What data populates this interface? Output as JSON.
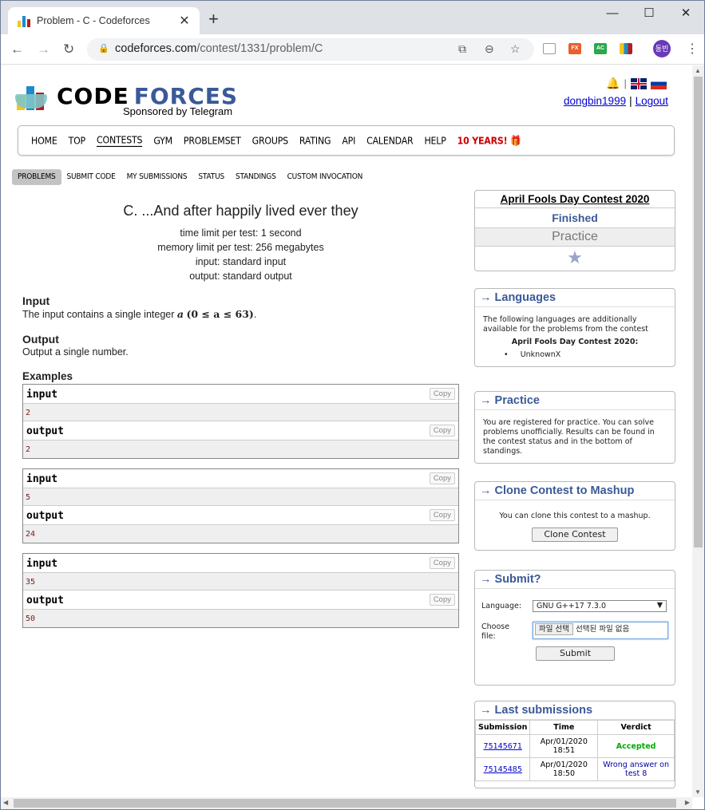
{
  "browser": {
    "tab_title": "Problem - C - Codeforces",
    "url_host": "codeforces.com",
    "url_path": "/contest/1331/problem/C",
    "profile_initials": "동빈",
    "extensions": [
      {
        "name": "FX",
        "color": "#e8602c"
      },
      {
        "name": "AC",
        "color": "#2aa84a"
      }
    ]
  },
  "header": {
    "logo_word1": "CODE",
    "logo_word2": "FORCES",
    "sponsor": "Sponsored by Telegram",
    "username": "dongbin1999",
    "separator": "|",
    "logout": "Logout"
  },
  "nav": {
    "items": [
      "HOME",
      "TOP",
      "CONTESTS",
      "GYM",
      "PROBLEMSET",
      "GROUPS",
      "RATING",
      "API",
      "CALENDAR",
      "HELP"
    ],
    "special": "10 YEARS! 🎁",
    "active": "CONTESTS"
  },
  "subnav": {
    "items": [
      "PROBLEMS",
      "SUBMIT CODE",
      "MY SUBMISSIONS",
      "STATUS",
      "STANDINGS",
      "CUSTOM INVOCATION"
    ],
    "active": "PROBLEMS"
  },
  "problem": {
    "title": "C. ...And after happily lived ever they",
    "time_limit": "time limit per test: 1 second",
    "memory_limit": "memory limit per test: 256 megabytes",
    "input": "input: standard input",
    "output": "output: standard output",
    "input_header": "Input",
    "input_text_pre": "The input contains a single integer ",
    "input_math_var": "a",
    "input_math_range": "(0 ≤ a ≤ 63)",
    "input_text_post": ".",
    "output_header": "Output",
    "output_text": "Output a single number.",
    "examples_header": "Examples",
    "input_label": "input",
    "output_label": "output",
    "copy_label": "Copy",
    "examples": [
      {
        "input": "2",
        "output": "2"
      },
      {
        "input": "5",
        "output": "24"
      },
      {
        "input": "35",
        "output": "50"
      }
    ]
  },
  "sidebar": {
    "contest": {
      "name": "April Fools Day Contest 2020",
      "phase": "Finished",
      "mode": "Practice",
      "star": "★"
    },
    "languages": {
      "title": "→ Languages",
      "text": "The following languages are additionally available for the problems from the contest",
      "contest_name": "April Fools Day Contest 2020:",
      "items": [
        "UnknownX"
      ]
    },
    "practice": {
      "title": "→ Practice",
      "text": "You are registered for practice. You can solve problems unofficially. Results can be found in the contest status and in the bottom of standings."
    },
    "clone": {
      "title": "→ Clone Contest to Mashup",
      "text": "You can clone this contest to a mashup.",
      "button": "Clone Contest"
    },
    "submit": {
      "title": "→ Submit?",
      "language_label": "Language:",
      "language_value": "GNU G++17 7.3.0",
      "file_label": "Choose file:",
      "file_button": "파일 선택",
      "file_status": "선택된 파일 없음",
      "submit_button": "Submit"
    },
    "last_submissions": {
      "title": "→ Last submissions",
      "columns": [
        "Submission",
        "Time",
        "Verdict"
      ],
      "rows": [
        {
          "id": "75145671",
          "time": "Apr/01/2020 18:51",
          "verdict": "Accepted",
          "status": "ok"
        },
        {
          "id": "75145485",
          "time": "Apr/01/2020 18:50",
          "verdict": "Wrong answer on test 8",
          "status": "wa"
        }
      ]
    }
  }
}
